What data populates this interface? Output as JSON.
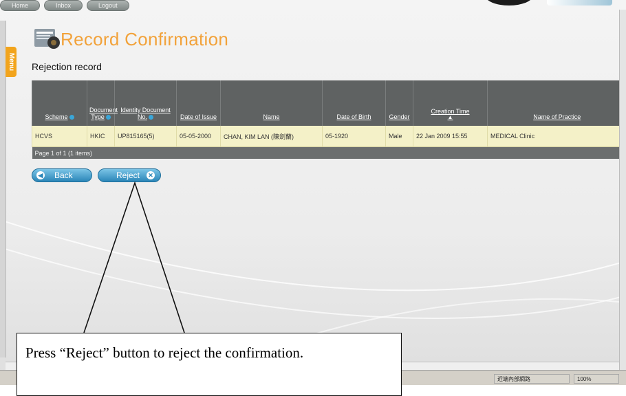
{
  "nav": {
    "items": [
      "Home",
      "Inbox",
      "Logout"
    ]
  },
  "menu_tab": "Menu",
  "page_title": "Record Confirmation",
  "section_title": "Rejection record",
  "table": {
    "headers": [
      "Scheme",
      "Document Type",
      "Identity Document No.",
      "Date of Issue",
      "Name",
      "Date of Birth",
      "Gender",
      "Creation Time",
      "Name of Practice"
    ],
    "sorted_column": "Creation Time",
    "rows": [
      [
        "HCVS",
        "HKIC",
        "UP815165(5)",
        "05-05-2000",
        "CHAN, KIM LAN (陳劍蘭)",
        "05-1920",
        "Male",
        "22 Jan 2009 15:55",
        "MEDICAL Clinic"
      ]
    ],
    "pager": "Page 1 of 1 (1 items)"
  },
  "buttons": {
    "back": "Back",
    "reject": "Reject"
  },
  "status_bar": {
    "zone": "近端內部網路",
    "zoom": "100%"
  },
  "callout": "Press “Reject” button to reject the confirmation.",
  "colors": {
    "title": "#f2a23a",
    "header_bg": "#5f6262",
    "row_bg": "#f4f1c8",
    "button": "#2b86b8",
    "menu_tab": "#f2a41c"
  }
}
